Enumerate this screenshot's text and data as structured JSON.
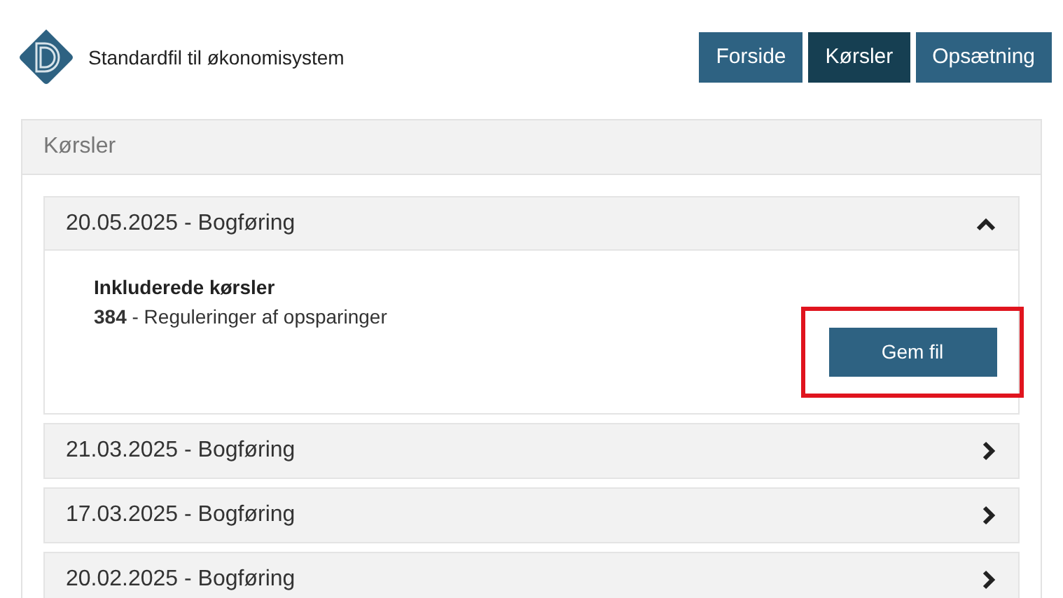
{
  "app": {
    "title": "Standardfil til økonomisystem"
  },
  "nav": [
    {
      "label": "Forside",
      "selected": false
    },
    {
      "label": "Kørsler",
      "selected": true
    },
    {
      "label": "Opsætning",
      "selected": false
    }
  ],
  "panel": {
    "title": "Kørsler",
    "runs": [
      {
        "title": "20.05.2025 - Bogføring",
        "expanded": true,
        "included_heading": "Inkluderede kørsler",
        "included": [
          "**384** - Reguleringer af opsparinger"
        ],
        "button": {
          "label": "Gem fil",
          "highlighted": true
        }
      },
      {
        "title": "21.03.2025 - Bogføring",
        "expanded": false
      },
      {
        "title": "17.03.2025 - Bogføring",
        "expanded": false
      },
      {
        "title": "20.02.2025 - Bogføring",
        "expanded": false
      }
    ]
  }
}
